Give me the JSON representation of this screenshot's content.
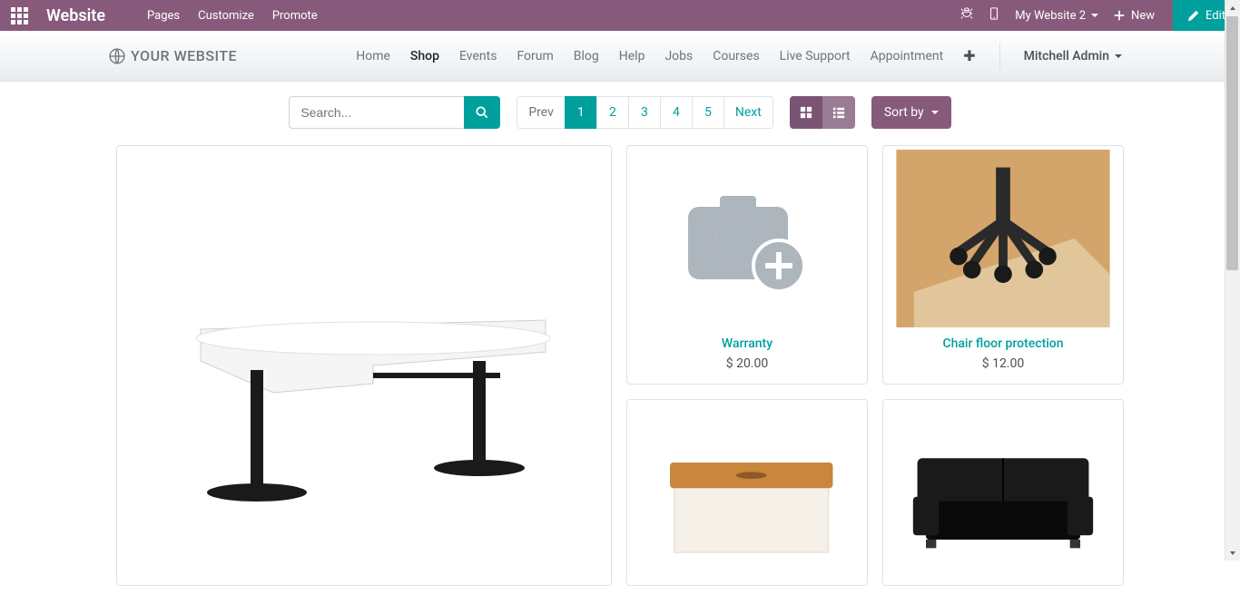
{
  "topbar": {
    "brand": "Website",
    "menu": [
      "Pages",
      "Customize",
      "Promote"
    ],
    "website_selector": "My Website 2",
    "new_label": "New",
    "edit_label": "Edit"
  },
  "navbar": {
    "logo_text": "YOUR WEBSITE",
    "links": [
      "Home",
      "Shop",
      "Events",
      "Forum",
      "Blog",
      "Help",
      "Jobs",
      "Courses",
      "Live Support",
      "Appointment"
    ],
    "active_link": "Shop",
    "user": "Mitchell Admin"
  },
  "toolbar": {
    "search_placeholder": "Search...",
    "pagination": {
      "prev": "Prev",
      "pages": [
        "1",
        "2",
        "3",
        "4",
        "5"
      ],
      "next": "Next",
      "active": "1"
    },
    "sort_label": "Sort by"
  },
  "products": [
    {
      "type": "large_desk"
    },
    {
      "title": "Warranty",
      "price": "$ 20.00",
      "image": "placeholder"
    },
    {
      "title": "Chair floor protection",
      "price": "$ 12.00",
      "image": "chair_mat"
    },
    {
      "title": "",
      "price": "",
      "image": "storage_box"
    },
    {
      "title": "",
      "price": "",
      "image": "sofa"
    }
  ]
}
